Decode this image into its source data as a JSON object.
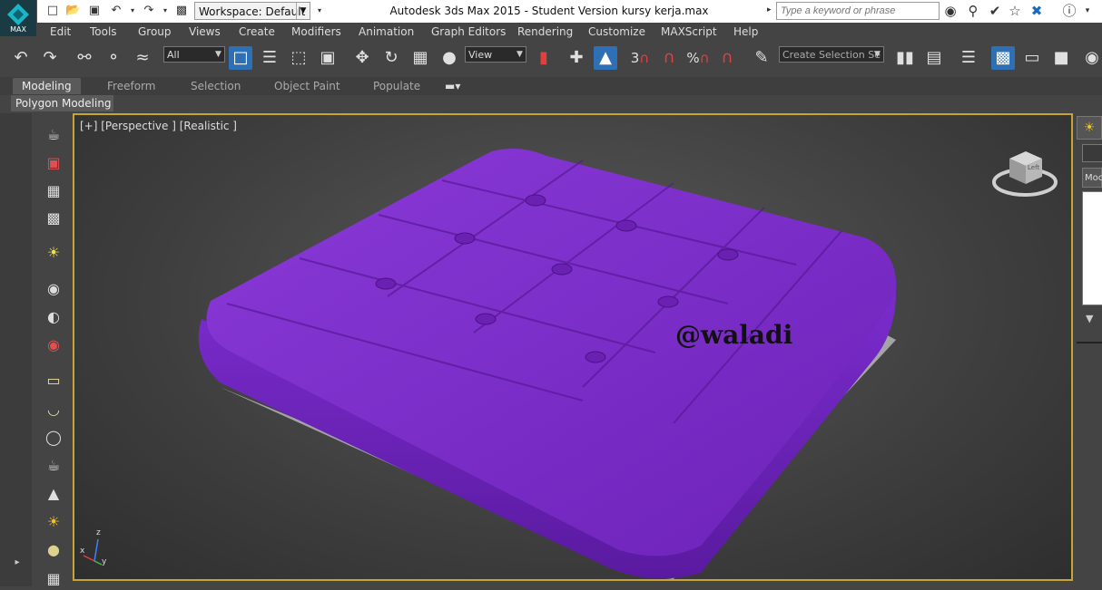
{
  "title_bar": {
    "app_title": "Autodesk 3ds Max  2015  -  Student Version     kursy kerja.max",
    "logo_label": "MAX",
    "workspace_value": "Workspace: Default",
    "search_placeholder": "Type a keyword or phrase",
    "quick_access_icons": [
      "new-file-icon",
      "open-file-icon",
      "save-icon",
      "undo-icon",
      "redo-icon",
      "project-folder-icon"
    ],
    "right_icons": [
      "binoculars-icon",
      "key-icon",
      "star-toggle-icon",
      "favorites-star-icon",
      "autodesk-x-icon",
      "help-icon",
      "minimize-icon"
    ]
  },
  "menu": {
    "items": [
      "Edit",
      "Tools",
      "Group",
      "Views",
      "Create",
      "Modifiers",
      "Animation",
      "Graph Editors",
      "Rendering",
      "Customize",
      "MAXScript",
      "Help"
    ]
  },
  "toolbar": {
    "selection_filter": "All",
    "reference_coord": "View",
    "selection_set_placeholder": "Create Selection Se",
    "snap_label": "3",
    "percent_snap_label": "%"
  },
  "ribbon": {
    "tabs": [
      "Modeling",
      "Freeform",
      "Selection",
      "Object Paint",
      "Populate"
    ],
    "active_tab": "Modeling",
    "panel_label": "Polygon Modeling"
  },
  "viewport": {
    "label": "[+] [Perspective ] [Realistic ]",
    "watermark": "@waladi",
    "axis_x": "x",
    "axis_y": "y",
    "axis_z": "z",
    "model_color": "#7b2fc4",
    "active_border_color": "#c7a43a"
  },
  "viewcube": {
    "face_label": "Left"
  },
  "command_panel": {
    "modify_label": "Moc"
  }
}
